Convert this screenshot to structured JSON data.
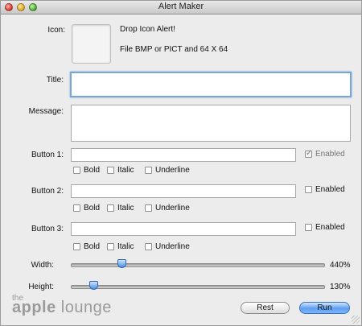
{
  "window": {
    "title": "Alert Maker"
  },
  "icon": {
    "label": "Icon:",
    "drop_hint": "Drop Icon Alert!",
    "format_hint": "File BMP or PICT and 64 X 64"
  },
  "title_field": {
    "label": "Title:",
    "value": ""
  },
  "message_field": {
    "label": "Message:",
    "value": ""
  },
  "buttons": [
    {
      "label": "Button 1:",
      "value": "",
      "enabled_label": "Enabled",
      "enabled": true,
      "enabled_dim": true,
      "bold_label": "Bold",
      "italic_label": "Italic",
      "underline_label": "Underline"
    },
    {
      "label": "Button 2:",
      "value": "",
      "enabled_label": "Enabled",
      "enabled": false,
      "enabled_dim": false,
      "bold_label": "Bold",
      "italic_label": "Italic",
      "underline_label": "Underline"
    },
    {
      "label": "Button 3:",
      "value": "",
      "enabled_label": "Enabled",
      "enabled": false,
      "enabled_dim": false,
      "bold_label": "Bold",
      "italic_label": "Italic",
      "underline_label": "Underline"
    }
  ],
  "width": {
    "label": "Width:",
    "value_text": "440%",
    "level": 0.2
  },
  "height": {
    "label": "Height:",
    "value_text": "130%",
    "level": 0.09
  },
  "actions": {
    "rest_label": "Rest",
    "run_label": "Run"
  },
  "watermark": {
    "small": "the",
    "big_1": "apple",
    "big_2": " lounge"
  },
  "colors": {
    "accent": "#5f9ff0",
    "focus_ring": "#7aa6d6"
  }
}
